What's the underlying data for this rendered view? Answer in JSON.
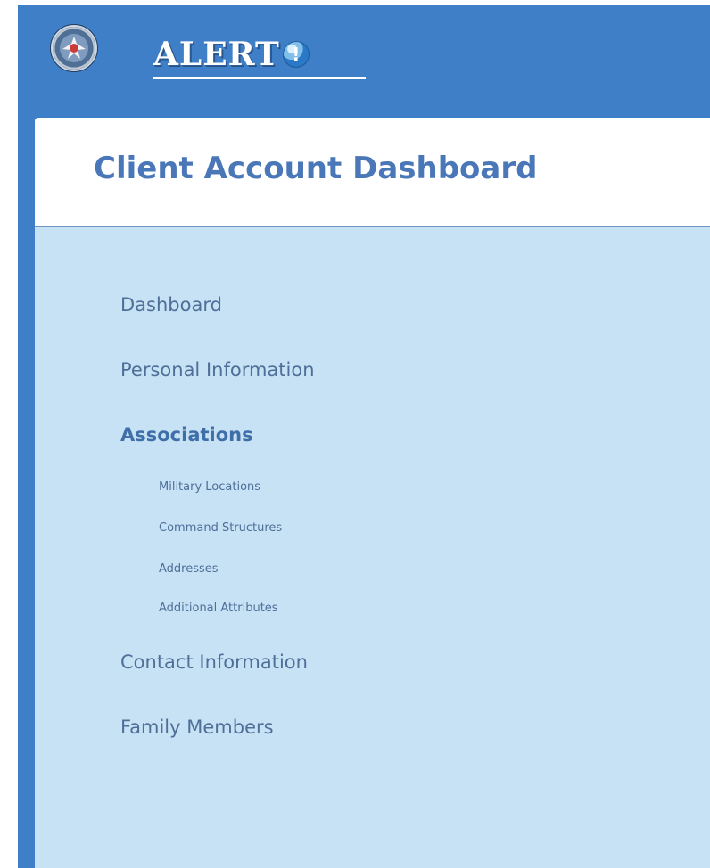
{
  "header": {
    "brand_name": "ALERT",
    "brand_icon": "exclamation-bubble-icon"
  },
  "page": {
    "title": "Client Account Dashboard"
  },
  "nav": {
    "items": [
      {
        "label": "Dashboard"
      },
      {
        "label": "Personal Information"
      },
      {
        "label": "Associations"
      },
      {
        "label": "Contact Information"
      },
      {
        "label": "Family Members"
      }
    ],
    "sub_items": [
      {
        "label": "Military Locations"
      },
      {
        "label": "Command Structures"
      },
      {
        "label": "Addresses"
      },
      {
        "label": "Additional Attributes"
      }
    ]
  },
  "colors": {
    "header_blue": "#3f7fc8",
    "panel_blue": "#c7e1f5",
    "title_blue": "#4a77b7",
    "nav_text": "#4f6f99"
  }
}
